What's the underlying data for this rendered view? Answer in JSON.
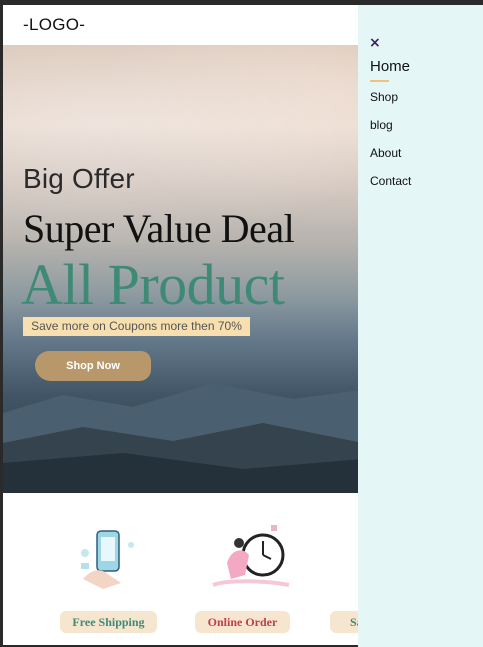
{
  "header": {
    "logo": "-LOGO-"
  },
  "hero": {
    "kicker": "Big Offer",
    "headline": "Super Value Deal",
    "highlight": "All Product",
    "coupon_text": "Save more on Coupons more then 70%",
    "cta_label": "Shop Now"
  },
  "features": [
    {
      "label": "Free Shipping",
      "icon": "phone-shipping-illustration"
    },
    {
      "label": "Online Order",
      "icon": "clock-order-illustration"
    },
    {
      "label": "Sa",
      "icon": "partial-illustration"
    }
  ],
  "sidenav": {
    "close_icon": "×",
    "items": [
      {
        "label": "Home",
        "active": true
      },
      {
        "label": "Shop"
      },
      {
        "label": "blog"
      },
      {
        "label": "About"
      },
      {
        "label": "Contact"
      }
    ]
  },
  "colors": {
    "accent_green": "#3f8a77",
    "accent_red": "#c0404a",
    "coupon_bg": "#f7dfb0",
    "sidenav_bg": "#e4f6f6",
    "cta_bg": "#b8986a"
  }
}
